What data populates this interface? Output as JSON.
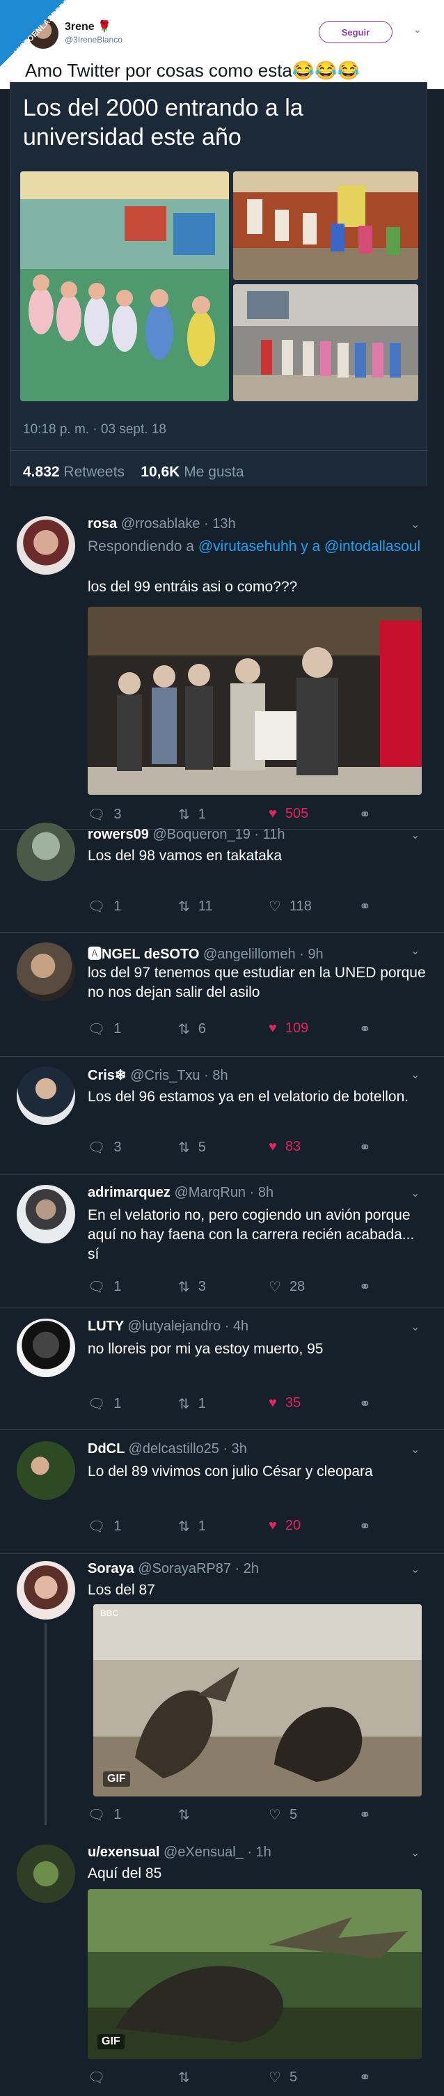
{
  "watermark": "VISTOENLASREDES",
  "header": {
    "name": "3rene 🌹",
    "handle": "@3IreneBlanco",
    "follow_label": "Seguir",
    "tweet_text": "Amo Twitter por cosas como esta😂😂😂"
  },
  "main": {
    "title": "Los del 2000 entrando a la universidad este año",
    "timestamp": "10:18 p. m. · 03 sept. 18",
    "retweets_count": "4.832",
    "retweets_label": "Retweets",
    "likes_count": "10,6K",
    "likes_label": "Me gusta"
  },
  "replies": [
    {
      "name": "rosa",
      "handle": "@rrosablake · 13h",
      "replying_prefix": "Respondiendo a",
      "replying_to": "@virutasehuhh y a @intodallasoul",
      "text": "los del 99 entráis asi o como???",
      "reply_count": "3",
      "retweet_count": "1",
      "like_count": "505",
      "liked": true
    },
    {
      "name": "rowers09",
      "handle": "@Boqueron_19 · 11h",
      "text": "Los del 98 vamos en takataka",
      "reply_count": "1",
      "retweet_count": "11",
      "like_count": "118",
      "liked": false
    },
    {
      "name": "🅰NGEL deSOTO",
      "handle": "@angelillomeh · 9h",
      "text": "los del 97 tenemos que estudiar en la UNED porque no nos dejan salir del asilo",
      "reply_count": "1",
      "retweet_count": "6",
      "like_count": "109",
      "liked": true
    },
    {
      "name": "Cris❄",
      "handle": "@Cris_Txu · 8h",
      "text": "Los del 96 estamos ya en el velatorio de botellon.",
      "reply_count": "3",
      "retweet_count": "5",
      "like_count": "83",
      "liked": true
    },
    {
      "name": "adrimarquez",
      "handle": "@MarqRun · 8h",
      "text": "En el velatorio no, pero cogiendo un avión porque aquí no hay faena con la carrera recién acabada... sí",
      "reply_count": "1",
      "retweet_count": "3",
      "like_count": "28",
      "liked": false
    },
    {
      "name": "LUTY",
      "handle": "@lutyalejandro · 4h",
      "text": "no lloreis por mi ya estoy muerto, 95",
      "reply_count": "1",
      "retweet_count": "1",
      "like_count": "35",
      "liked": true
    },
    {
      "name": "DdCL",
      "handle": "@delcastillo25 · 3h",
      "text": "Lo del 89 vivimos con julio César y cleopara",
      "reply_count": "1",
      "retweet_count": "1",
      "like_count": "20",
      "liked": true
    },
    {
      "name": "Soraya",
      "handle": "@SorayaRP87 · 2h",
      "text": "Los del 87",
      "gif_label": "GIF",
      "media_watermark": "BBC",
      "reply_count": "1",
      "retweet_count": "",
      "like_count": "5",
      "liked": false
    },
    {
      "name": "u/exensual",
      "handle": "@eXensual_ · 1h",
      "text": "Aquí del 85",
      "gif_label": "GIF",
      "reply_count": "",
      "retweet_count": "",
      "like_count": "5",
      "liked": false
    }
  ],
  "icons": [
    "reply-icon",
    "retweet-icon",
    "heart-icon",
    "share-icon",
    "chevron-down-icon"
  ],
  "colors": {
    "background": "#15202b",
    "card": "#1c2938",
    "muted": "#8899a6",
    "link": "#1da1f2",
    "like": "#e0245e",
    "follow": "#8a3ea7"
  }
}
